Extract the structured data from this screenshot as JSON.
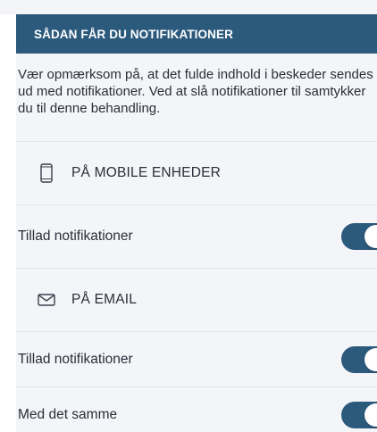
{
  "header": {
    "title": "SÅDAN FÅR DU NOTIFIKATIONER"
  },
  "intro": {
    "text": "Vær opmærksom på, at det fulde indhold i beskeder sendes ud med notifikationer. Ved at slå notifikationer til samtykker du til denne behandling."
  },
  "mobile": {
    "icon": "phone-icon",
    "label": "PÅ MOBILE ENHEDER",
    "settings": [
      {
        "label": "Tillad notifikationer",
        "enabled": true
      }
    ]
  },
  "email": {
    "icon": "mail-icon",
    "label": "PÅ EMAIL",
    "settings": [
      {
        "label": "Tillad notifikationer",
        "enabled": true
      },
      {
        "label": "Med det samme",
        "enabled": true
      }
    ]
  },
  "colors": {
    "header_bg": "#2c5a7d",
    "panel_bg": "#f3f5f8",
    "toggle_on": "#2c5a7d",
    "divider": "#e1e4e9",
    "text": "#2a2f3a"
  }
}
